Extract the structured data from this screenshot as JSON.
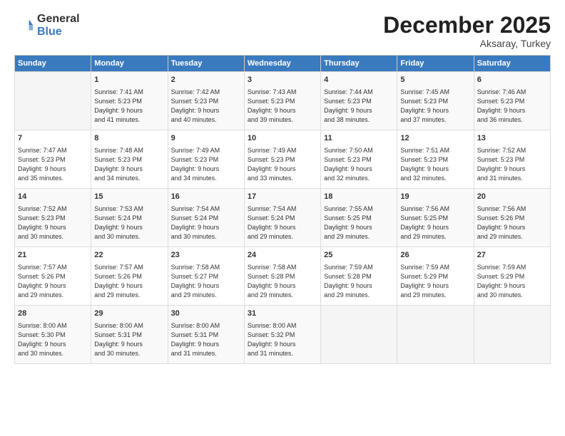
{
  "logo": {
    "general": "General",
    "blue": "Blue"
  },
  "title": "December 2025",
  "subtitle": "Aksaray, Turkey",
  "days_header": [
    "Sunday",
    "Monday",
    "Tuesday",
    "Wednesday",
    "Thursday",
    "Friday",
    "Saturday"
  ],
  "weeks": [
    [
      {
        "day": "",
        "info": ""
      },
      {
        "day": "1",
        "info": "Sunrise: 7:41 AM\nSunset: 5:23 PM\nDaylight: 9 hours\nand 41 minutes."
      },
      {
        "day": "2",
        "info": "Sunrise: 7:42 AM\nSunset: 5:23 PM\nDaylight: 9 hours\nand 40 minutes."
      },
      {
        "day": "3",
        "info": "Sunrise: 7:43 AM\nSunset: 5:23 PM\nDaylight: 9 hours\nand 39 minutes."
      },
      {
        "day": "4",
        "info": "Sunrise: 7:44 AM\nSunset: 5:23 PM\nDaylight: 9 hours\nand 38 minutes."
      },
      {
        "day": "5",
        "info": "Sunrise: 7:45 AM\nSunset: 5:23 PM\nDaylight: 9 hours\nand 37 minutes."
      },
      {
        "day": "6",
        "info": "Sunrise: 7:46 AM\nSunset: 5:23 PM\nDaylight: 9 hours\nand 36 minutes."
      }
    ],
    [
      {
        "day": "7",
        "info": "Sunrise: 7:47 AM\nSunset: 5:23 PM\nDaylight: 9 hours\nand 35 minutes."
      },
      {
        "day": "8",
        "info": "Sunrise: 7:48 AM\nSunset: 5:23 PM\nDaylight: 9 hours\nand 34 minutes."
      },
      {
        "day": "9",
        "info": "Sunrise: 7:49 AM\nSunset: 5:23 PM\nDaylight: 9 hours\nand 34 minutes."
      },
      {
        "day": "10",
        "info": "Sunrise: 7:49 AM\nSunset: 5:23 PM\nDaylight: 9 hours\nand 33 minutes."
      },
      {
        "day": "11",
        "info": "Sunrise: 7:50 AM\nSunset: 5:23 PM\nDaylight: 9 hours\nand 32 minutes."
      },
      {
        "day": "12",
        "info": "Sunrise: 7:51 AM\nSunset: 5:23 PM\nDaylight: 9 hours\nand 32 minutes."
      },
      {
        "day": "13",
        "info": "Sunrise: 7:52 AM\nSunset: 5:23 PM\nDaylight: 9 hours\nand 31 minutes."
      }
    ],
    [
      {
        "day": "14",
        "info": "Sunrise: 7:52 AM\nSunset: 5:23 PM\nDaylight: 9 hours\nand 30 minutes."
      },
      {
        "day": "15",
        "info": "Sunrise: 7:53 AM\nSunset: 5:24 PM\nDaylight: 9 hours\nand 30 minutes."
      },
      {
        "day": "16",
        "info": "Sunrise: 7:54 AM\nSunset: 5:24 PM\nDaylight: 9 hours\nand 30 minutes."
      },
      {
        "day": "17",
        "info": "Sunrise: 7:54 AM\nSunset: 5:24 PM\nDaylight: 9 hours\nand 29 minutes."
      },
      {
        "day": "18",
        "info": "Sunrise: 7:55 AM\nSunset: 5:25 PM\nDaylight: 9 hours\nand 29 minutes."
      },
      {
        "day": "19",
        "info": "Sunrise: 7:56 AM\nSunset: 5:25 PM\nDaylight: 9 hours\nand 29 minutes."
      },
      {
        "day": "20",
        "info": "Sunrise: 7:56 AM\nSunset: 5:26 PM\nDaylight: 9 hours\nand 29 minutes."
      }
    ],
    [
      {
        "day": "21",
        "info": "Sunrise: 7:57 AM\nSunset: 5:26 PM\nDaylight: 9 hours\nand 29 minutes."
      },
      {
        "day": "22",
        "info": "Sunrise: 7:57 AM\nSunset: 5:26 PM\nDaylight: 9 hours\nand 29 minutes."
      },
      {
        "day": "23",
        "info": "Sunrise: 7:58 AM\nSunset: 5:27 PM\nDaylight: 9 hours\nand 29 minutes."
      },
      {
        "day": "24",
        "info": "Sunrise: 7:58 AM\nSunset: 5:28 PM\nDaylight: 9 hours\nand 29 minutes."
      },
      {
        "day": "25",
        "info": "Sunrise: 7:59 AM\nSunset: 5:28 PM\nDaylight: 9 hours\nand 29 minutes."
      },
      {
        "day": "26",
        "info": "Sunrise: 7:59 AM\nSunset: 5:29 PM\nDaylight: 9 hours\nand 29 minutes."
      },
      {
        "day": "27",
        "info": "Sunrise: 7:59 AM\nSunset: 5:29 PM\nDaylight: 9 hours\nand 30 minutes."
      }
    ],
    [
      {
        "day": "28",
        "info": "Sunrise: 8:00 AM\nSunset: 5:30 PM\nDaylight: 9 hours\nand 30 minutes."
      },
      {
        "day": "29",
        "info": "Sunrise: 8:00 AM\nSunset: 5:31 PM\nDaylight: 9 hours\nand 30 minutes."
      },
      {
        "day": "30",
        "info": "Sunrise: 8:00 AM\nSunset: 5:31 PM\nDaylight: 9 hours\nand 31 minutes."
      },
      {
        "day": "31",
        "info": "Sunrise: 8:00 AM\nSunset: 5:32 PM\nDaylight: 9 hours\nand 31 minutes."
      },
      {
        "day": "",
        "info": ""
      },
      {
        "day": "",
        "info": ""
      },
      {
        "day": "",
        "info": ""
      }
    ]
  ]
}
